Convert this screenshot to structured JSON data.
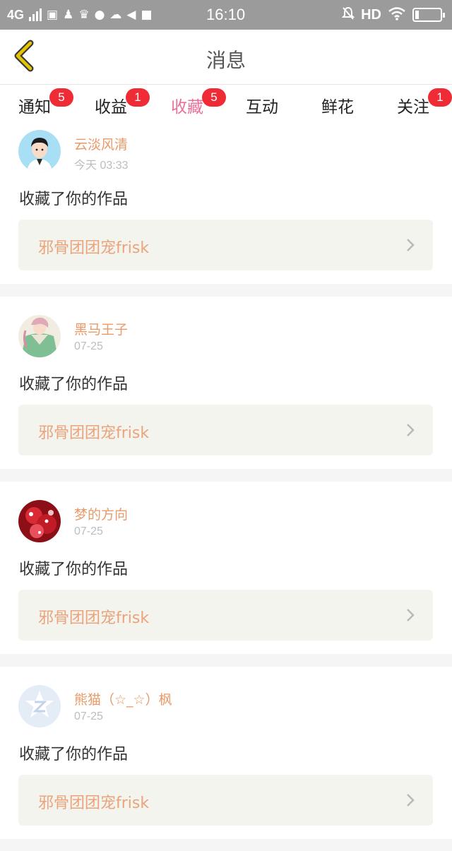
{
  "status_bar": {
    "network": "4G",
    "time": "16:10",
    "hd": "HD"
  },
  "header": {
    "title": "消息",
    "back_icon": "chevron-left-icon",
    "accent_color": "#e5c400"
  },
  "tabs": [
    {
      "label": "通知",
      "badge": "5"
    },
    {
      "label": "收益",
      "badge": "1"
    },
    {
      "label": "收藏",
      "badge": "5",
      "active": true
    },
    {
      "label": "互动",
      "badge": ""
    },
    {
      "label": "鲜花",
      "badge": ""
    },
    {
      "label": "关注",
      "badge": "1"
    }
  ],
  "colors": {
    "active_tab": "#e8709a",
    "badge": "#ef2b36",
    "username": "#e89a68",
    "work_title": "#eba37c",
    "work_box_bg": "#f4f4ee"
  },
  "notifications": [
    {
      "user": "云淡风清",
      "time": "今天 03:33",
      "action": "收藏了你的作品",
      "work": "邪骨团团宠frisk"
    },
    {
      "user": "黑马王子",
      "time": "07-25",
      "action": "收藏了你的作品",
      "work": "邪骨团团宠frisk"
    },
    {
      "user": "梦的方向",
      "time": "07-25",
      "action": "收藏了你的作品",
      "work": "邪骨团团宠frisk"
    },
    {
      "user": "熊猫（☆_☆）枫",
      "time": "07-25",
      "action": "收藏了你的作品",
      "work": "邪骨团团宠frisk"
    }
  ]
}
